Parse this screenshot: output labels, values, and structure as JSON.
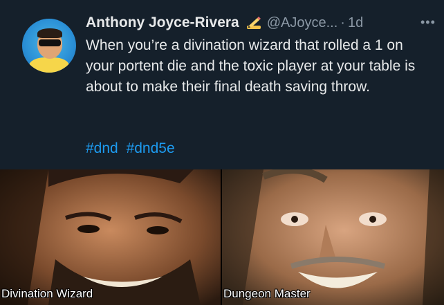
{
  "tweet": {
    "author_name": "Anthony Joyce-Rivera",
    "author_badge_icon": "writing-hand-emoji",
    "handle": "@AJoyce...",
    "separator": "·",
    "timestamp": "1d",
    "more_icon": "ellipsis-icon",
    "text": "When you’re a divination wizard that rolled a 1 on your portent die and the toxic player at your table is about to make their final death saving throw.",
    "hashtags": [
      "#dnd",
      "#dnd5e"
    ]
  },
  "meme": {
    "left_caption": "Divination Wizard",
    "right_caption": "Dungeon Master"
  },
  "colors": {
    "background": "#15202b",
    "primary_text": "#e7e9ea",
    "secondary_text": "#8b98a5",
    "link": "#1d9bf0"
  }
}
